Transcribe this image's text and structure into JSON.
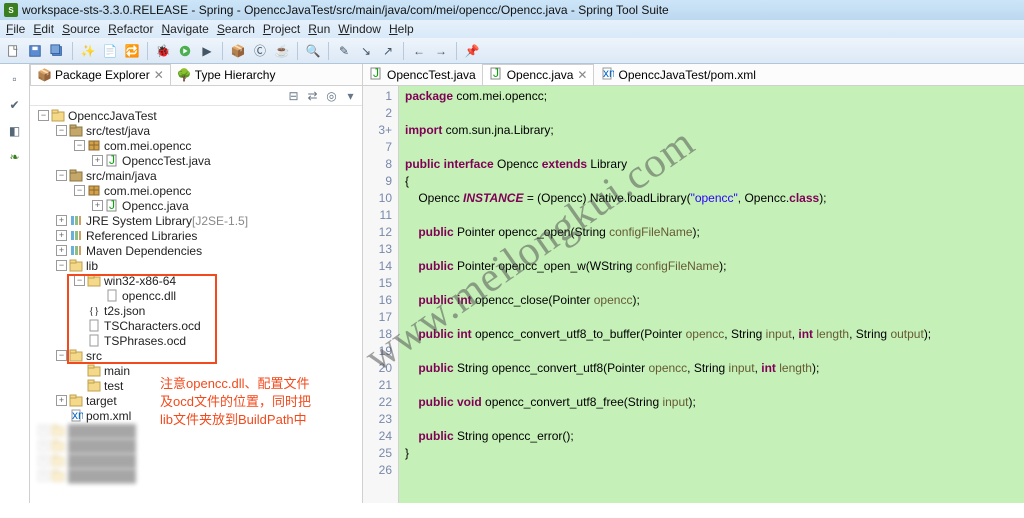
{
  "window": {
    "title": "workspace-sts-3.3.0.RELEASE - Spring - OpenccJavaTest/src/main/java/com/mei/opencc/Opencc.java - Spring Tool Suite"
  },
  "menu": [
    "File",
    "Edit",
    "Source",
    "Refactor",
    "Navigate",
    "Search",
    "Project",
    "Run",
    "Window",
    "Help"
  ],
  "explorer": {
    "tab_active": "Package Explorer",
    "tab_inactive": "Type Hierarchy",
    "tree": [
      {
        "depth": 0,
        "twist": "open",
        "icon": "project",
        "label": "OpenccJavaTest"
      },
      {
        "depth": 1,
        "twist": "open",
        "icon": "srcfolder",
        "label": "src/test/java"
      },
      {
        "depth": 2,
        "twist": "open",
        "icon": "package",
        "label": "com.mei.opencc"
      },
      {
        "depth": 3,
        "twist": "closed",
        "icon": "junit",
        "label": "OpenccTest.java"
      },
      {
        "depth": 1,
        "twist": "open",
        "icon": "srcfolder",
        "label": "src/main/java"
      },
      {
        "depth": 2,
        "twist": "open",
        "icon": "package",
        "label": "com.mei.opencc"
      },
      {
        "depth": 3,
        "twist": "closed",
        "icon": "junit",
        "label": "Opencc.java"
      },
      {
        "depth": 1,
        "twist": "closed",
        "icon": "library",
        "label": "JRE System Library",
        "suffix": " [J2SE-1.5]"
      },
      {
        "depth": 1,
        "twist": "closed",
        "icon": "library",
        "label": "Referenced Libraries"
      },
      {
        "depth": 1,
        "twist": "closed",
        "icon": "library",
        "label": "Maven Dependencies"
      },
      {
        "depth": 1,
        "twist": "open",
        "icon": "folder-lib",
        "label": "lib"
      },
      {
        "depth": 2,
        "twist": "open",
        "icon": "folder",
        "label": "win32-x86-64"
      },
      {
        "depth": 3,
        "twist": "empty",
        "icon": "file",
        "label": "opencc.dll"
      },
      {
        "depth": 2,
        "twist": "empty",
        "icon": "braces",
        "label": "t2s.json"
      },
      {
        "depth": 2,
        "twist": "empty",
        "icon": "file",
        "label": "TSCharacters.ocd"
      },
      {
        "depth": 2,
        "twist": "empty",
        "icon": "file",
        "label": "TSPhrases.ocd"
      },
      {
        "depth": 1,
        "twist": "open",
        "icon": "folder",
        "label": "src"
      },
      {
        "depth": 2,
        "twist": "empty",
        "icon": "folder",
        "label": "main"
      },
      {
        "depth": 2,
        "twist": "empty",
        "icon": "folder",
        "label": "test"
      },
      {
        "depth": 1,
        "twist": "closed",
        "icon": "folder",
        "label": "target"
      },
      {
        "depth": 1,
        "twist": "empty",
        "icon": "xml",
        "label": "pom.xml"
      }
    ]
  },
  "annotation": {
    "line1": "注意opencc.dll、配置文件",
    "line2": "及ocd文件的位置，同时把",
    "line3": "lib文件夹放到BuildPath中"
  },
  "editor_tabs": [
    {
      "label": "OpenccTest.java",
      "icon": "junit",
      "active": false
    },
    {
      "label": "Opencc.java",
      "icon": "junit",
      "active": true
    },
    {
      "label": "OpenccJavaTest/pom.xml",
      "icon": "xml",
      "active": false
    }
  ],
  "code_lines": [
    {
      "n": 1,
      "segs": [
        [
          "kw",
          "package"
        ],
        [
          "txt",
          " com.mei.opencc;"
        ]
      ]
    },
    {
      "n": 2,
      "segs": []
    },
    {
      "n": "3+",
      "segs": [
        [
          "kw",
          "import"
        ],
        [
          "txt",
          " com.sun.jna.Library;"
        ]
      ]
    },
    {
      "n": 7,
      "segs": []
    },
    {
      "n": 8,
      "segs": [
        [
          "kw",
          "public interface"
        ],
        [
          "txt",
          " Opencc "
        ],
        [
          "kw",
          "extends"
        ],
        [
          "txt",
          " Library"
        ]
      ]
    },
    {
      "n": 9,
      "segs": [
        [
          "txt",
          "{"
        ]
      ]
    },
    {
      "n": 10,
      "segs": [
        [
          "txt",
          "    Opencc "
        ],
        [
          "kwi",
          "INSTANCE"
        ],
        [
          "txt",
          " = (Opencc) Native."
        ],
        [
          "txt",
          "loadLibrary"
        ],
        [
          "txt",
          "("
        ],
        [
          "str",
          "\"opencc\""
        ],
        [
          "txt",
          ", Opencc."
        ],
        [
          "kw",
          "class"
        ],
        [
          "txt",
          ");"
        ]
      ]
    },
    {
      "n": 11,
      "segs": []
    },
    {
      "n": 12,
      "segs": [
        [
          "txt",
          "    "
        ],
        [
          "kw",
          "public"
        ],
        [
          "txt",
          " Pointer opencc_open(String "
        ],
        [
          "param",
          "configFileName"
        ],
        [
          "txt",
          ");"
        ]
      ]
    },
    {
      "n": 13,
      "segs": []
    },
    {
      "n": 14,
      "segs": [
        [
          "txt",
          "    "
        ],
        [
          "kw",
          "public"
        ],
        [
          "txt",
          " Pointer opencc_open_w(WString "
        ],
        [
          "param",
          "configFileName"
        ],
        [
          "txt",
          ");"
        ]
      ]
    },
    {
      "n": 15,
      "segs": []
    },
    {
      "n": 16,
      "segs": [
        [
          "txt",
          "    "
        ],
        [
          "kw",
          "public int"
        ],
        [
          "txt",
          " opencc_close(Pointer "
        ],
        [
          "param",
          "opencc"
        ],
        [
          "txt",
          ");"
        ]
      ]
    },
    {
      "n": 17,
      "segs": []
    },
    {
      "n": 18,
      "segs": [
        [
          "txt",
          "    "
        ],
        [
          "kw",
          "public int"
        ],
        [
          "txt",
          " opencc_convert_utf8_to_buffer(Pointer "
        ],
        [
          "param",
          "opencc"
        ],
        [
          "txt",
          ", String "
        ],
        [
          "param",
          "input"
        ],
        [
          "txt",
          ", "
        ],
        [
          "kw",
          "int"
        ],
        [
          "txt",
          " "
        ],
        [
          "param",
          "length"
        ],
        [
          "txt",
          ", String "
        ],
        [
          "param",
          "output"
        ],
        [
          "txt",
          ");"
        ]
      ]
    },
    {
      "n": 19,
      "segs": []
    },
    {
      "n": 20,
      "segs": [
        [
          "txt",
          "    "
        ],
        [
          "kw",
          "public"
        ],
        [
          "txt",
          " String opencc_convert_utf8(Pointer "
        ],
        [
          "param",
          "opencc"
        ],
        [
          "txt",
          ", String "
        ],
        [
          "param",
          "input"
        ],
        [
          "txt",
          ", "
        ],
        [
          "kw",
          "int"
        ],
        [
          "txt",
          " "
        ],
        [
          "param",
          "length"
        ],
        [
          "txt",
          ");"
        ]
      ]
    },
    {
      "n": 21,
      "segs": []
    },
    {
      "n": 22,
      "segs": [
        [
          "txt",
          "    "
        ],
        [
          "kw",
          "public void"
        ],
        [
          "txt",
          " opencc_convert_utf8_free(String "
        ],
        [
          "param",
          "input"
        ],
        [
          "txt",
          ");"
        ]
      ]
    },
    {
      "n": 23,
      "segs": []
    },
    {
      "n": 24,
      "segs": [
        [
          "txt",
          "    "
        ],
        [
          "kw",
          "public"
        ],
        [
          "txt",
          " String opencc_error();"
        ]
      ]
    },
    {
      "n": 25,
      "segs": [
        [
          "txt",
          "}"
        ]
      ]
    },
    {
      "n": 26,
      "segs": []
    }
  ],
  "watermark": "www.meilongkui.com"
}
